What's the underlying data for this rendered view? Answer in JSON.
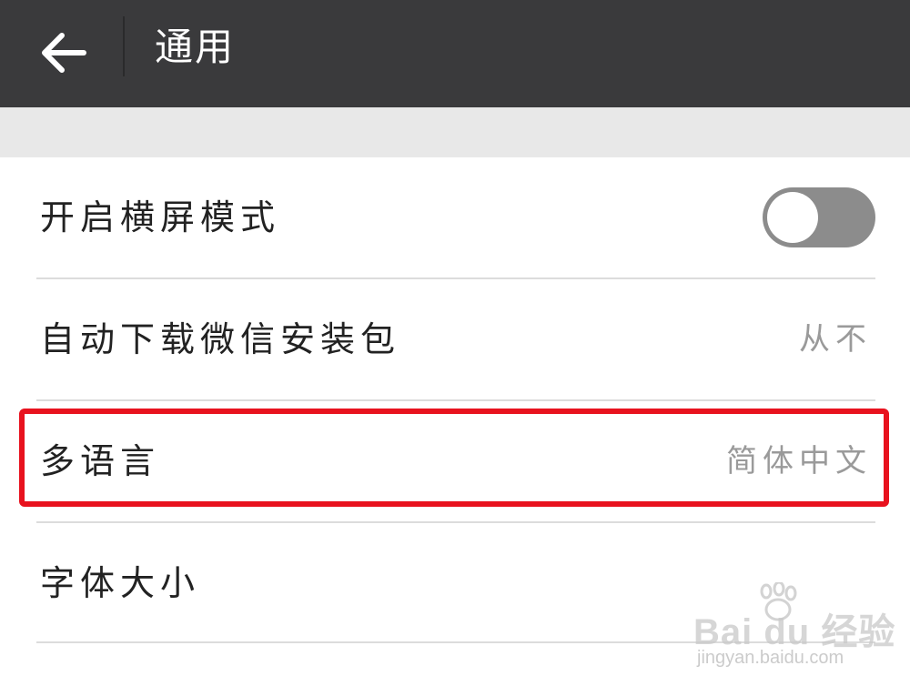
{
  "header": {
    "title": "通用",
    "back_icon": "arrow-left-icon"
  },
  "settings": {
    "landscape_mode": {
      "label": "开启横屏模式",
      "enabled": false
    },
    "auto_download": {
      "label": "自动下载微信安装包",
      "value": "从不"
    },
    "language": {
      "label": "多语言",
      "value": "简体中文"
    },
    "font_size": {
      "label": "字体大小"
    }
  },
  "annotation": {
    "highlight_color": "#e8121e"
  },
  "watermark": {
    "logo_text": "Bai du 经验",
    "url_text": "jingyan.baidu.com"
  },
  "colors": {
    "header_bg": "#3a3a3c",
    "section_gap": "#e8e8e8",
    "toggle_off": "#8c8c8c"
  }
}
